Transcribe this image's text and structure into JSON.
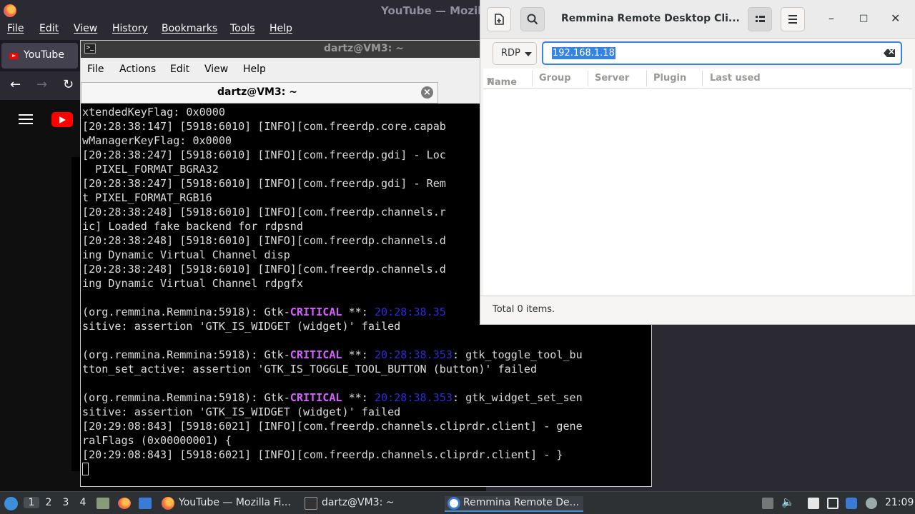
{
  "firefox": {
    "title": "YouTube — Mozill",
    "menu": [
      "File",
      "Edit",
      "View",
      "History",
      "Bookmarks",
      "Tools",
      "Help"
    ],
    "tab_label": "YouTube",
    "nav": {
      "back": "←",
      "forward": "→",
      "reload": "↻"
    }
  },
  "terminal": {
    "title": "dartz@VM3: ~",
    "menu": [
      "File",
      "Actions",
      "Edit",
      "View",
      "Help"
    ],
    "tab_title": "dartz@VM3: ~",
    "lines": [
      [
        "xtendedKeyFlag: 0x0000"
      ],
      [
        "[20:28:38:147] [5918:6010] [INFO][com.freerdp.core.capab"
      ],
      [
        "wManagerKeyFlag: 0x0000"
      ],
      [
        "[20:28:38:247] [5918:6010] [INFO][com.freerdp.gdi] - Loc"
      ],
      [
        "  PIXEL_FORMAT_BGRA32"
      ],
      [
        "[20:28:38:247] [5918:6010] [INFO][com.freerdp.gdi] - Rem"
      ],
      [
        "t PIXEL_FORMAT_RGB16"
      ],
      [
        "[20:28:38:248] [5918:6010] [INFO][com.freerdp.channels.r"
      ],
      [
        "ic] Loaded fake backend for rdpsnd"
      ],
      [
        "[20:28:38:248] [5918:6010] [INFO][com.freerdp.channels.d"
      ],
      [
        "ing Dynamic Virtual Channel disp"
      ],
      [
        "[20:28:38:248] [5918:6010] [INFO][com.freerdp.channels.d"
      ],
      [
        "ing Dynamic Virtual Channel rdpgfx"
      ],
      [
        ""
      ],
      [
        "(org.remmina.Remmina:5918): Gtk-",
        "CRITICAL",
        " **: ",
        "20:28:38.35",
        ""
      ],
      [
        "sitive: assertion 'GTK_IS_WIDGET (widget)' failed"
      ],
      [
        ""
      ],
      [
        "(org.remmina.Remmina:5918): Gtk-",
        "CRITICAL",
        " **: ",
        "20:28:38.353",
        ": gtk_toggle_tool_bu"
      ],
      [
        "tton_set_active: assertion 'GTK_IS_TOGGLE_TOOL_BUTTON (button)' failed"
      ],
      [
        ""
      ],
      [
        "(org.remmina.Remmina:5918): Gtk-",
        "CRITICAL",
        " **: ",
        "20:28:38.353",
        ": gtk_widget_set_sen"
      ],
      [
        "sitive: assertion 'GTK_IS_WIDGET (widget)' failed"
      ],
      [
        "[20:29:08:843] [5918:6021] [INFO][com.freerdp.channels.cliprdr.client] - gene"
      ],
      [
        "ralFlags (0x00000001) {"
      ],
      [
        "[20:29:08:843] [5918:6021] [INFO][com.freerdp.channels.cliprdr.client] - }"
      ]
    ]
  },
  "remmina": {
    "title": "Remmina Remote Desktop Cli...",
    "protocol": "RDP",
    "address_value": "192.168.1.18",
    "columns": [
      "Name",
      "Group",
      "Server",
      "Plugin",
      "Last used"
    ],
    "status": "Total 0 items.",
    "controls": {
      "minimize": "–",
      "maximize": "□",
      "close": "✕"
    }
  },
  "taskbar": {
    "workspaces": [
      "1",
      "2",
      "3",
      "4"
    ],
    "tasks": [
      {
        "label": "YouTube — Mozilla Fi...",
        "icon": "firefox-icon"
      },
      {
        "label": "dartz@VM3: ~",
        "icon": "terminal-icon"
      },
      {
        "label": "Remmina Remote De...",
        "icon": "remmina-icon"
      }
    ],
    "clock": "21:09"
  },
  "colors": {
    "critical": "#d75fff",
    "timestamp": "#2b2bd8",
    "accent": "#3584e4"
  }
}
